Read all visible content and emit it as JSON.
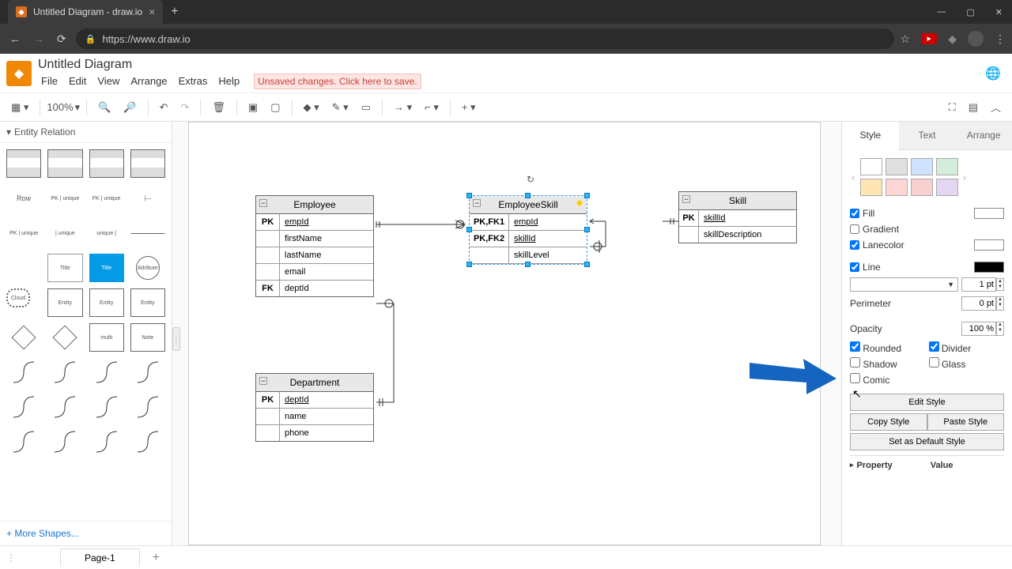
{
  "browser": {
    "tab_title": "Untitled Diagram - draw.io",
    "url": "https://www.draw.io"
  },
  "app": {
    "title": "Untitled Diagram",
    "menu": [
      "File",
      "Edit",
      "View",
      "Arrange",
      "Extras",
      "Help"
    ],
    "warning": "Unsaved changes. Click here to save."
  },
  "toolbar": {
    "zoom": "100%"
  },
  "sidebar": {
    "section": "Entity Relation",
    "row_label": "Row",
    "more_shapes": "+ More Shapes..."
  },
  "canvas": {
    "entities": {
      "employee": {
        "title": "Employee",
        "rows": [
          {
            "key": "PK",
            "field": "empId",
            "underline": true
          },
          {
            "key": "",
            "field": "firstName"
          },
          {
            "key": "",
            "field": "lastName"
          },
          {
            "key": "",
            "field": "email"
          },
          {
            "key": "FK",
            "field": "deptId"
          }
        ]
      },
      "employeeskill": {
        "title": "EmployeeSkill",
        "rows": [
          {
            "key": "PK,FK1",
            "field": "empId",
            "underline": true
          },
          {
            "key": "PK,FK2",
            "field": "skillId",
            "underline": true
          },
          {
            "key": "",
            "field": "skillLevel"
          }
        ]
      },
      "skill": {
        "title": "Skill",
        "rows": [
          {
            "key": "PK",
            "field": "skillId",
            "underline": true
          },
          {
            "key": "",
            "field": "skillDescription"
          }
        ]
      },
      "department": {
        "title": "Department",
        "rows": [
          {
            "key": "PK",
            "field": "deptId",
            "underline": true
          },
          {
            "key": "",
            "field": "name"
          },
          {
            "key": "",
            "field": "phone"
          }
        ]
      }
    }
  },
  "panel": {
    "tabs": [
      "Style",
      "Text",
      "Arrange"
    ],
    "swatches_top": [
      "#ffffff",
      "#e0e0e0",
      "#cfe2ff",
      "#d4edda"
    ],
    "swatches_bot": [
      "#ffe5b4",
      "#ffd6d6",
      "#f8d0d0",
      "#e2d6f3"
    ],
    "fill": {
      "label": "Fill",
      "checked": true,
      "color": "#ffffff"
    },
    "gradient": {
      "label": "Gradient",
      "checked": false
    },
    "lanecolor": {
      "label": "Lanecolor",
      "checked": true,
      "color": "#ffffff"
    },
    "line": {
      "label": "Line",
      "checked": true,
      "color": "#000000",
      "width": "1 pt"
    },
    "perimeter": {
      "label": "Perimeter",
      "value": "0 pt"
    },
    "opacity": {
      "label": "Opacity",
      "value": "100 %"
    },
    "rounded": {
      "label": "Rounded",
      "checked": true
    },
    "divider": {
      "label": "Divider",
      "checked": true
    },
    "shadow": {
      "label": "Shadow",
      "checked": false
    },
    "glass": {
      "label": "Glass",
      "checked": false
    },
    "comic": {
      "label": "Comic",
      "checked": false
    },
    "edit_style": "Edit Style",
    "copy_style": "Copy Style",
    "paste_style": "Paste Style",
    "default_style": "Set as Default Style",
    "property": "Property",
    "value": "Value"
  },
  "footer": {
    "page": "Page-1"
  }
}
